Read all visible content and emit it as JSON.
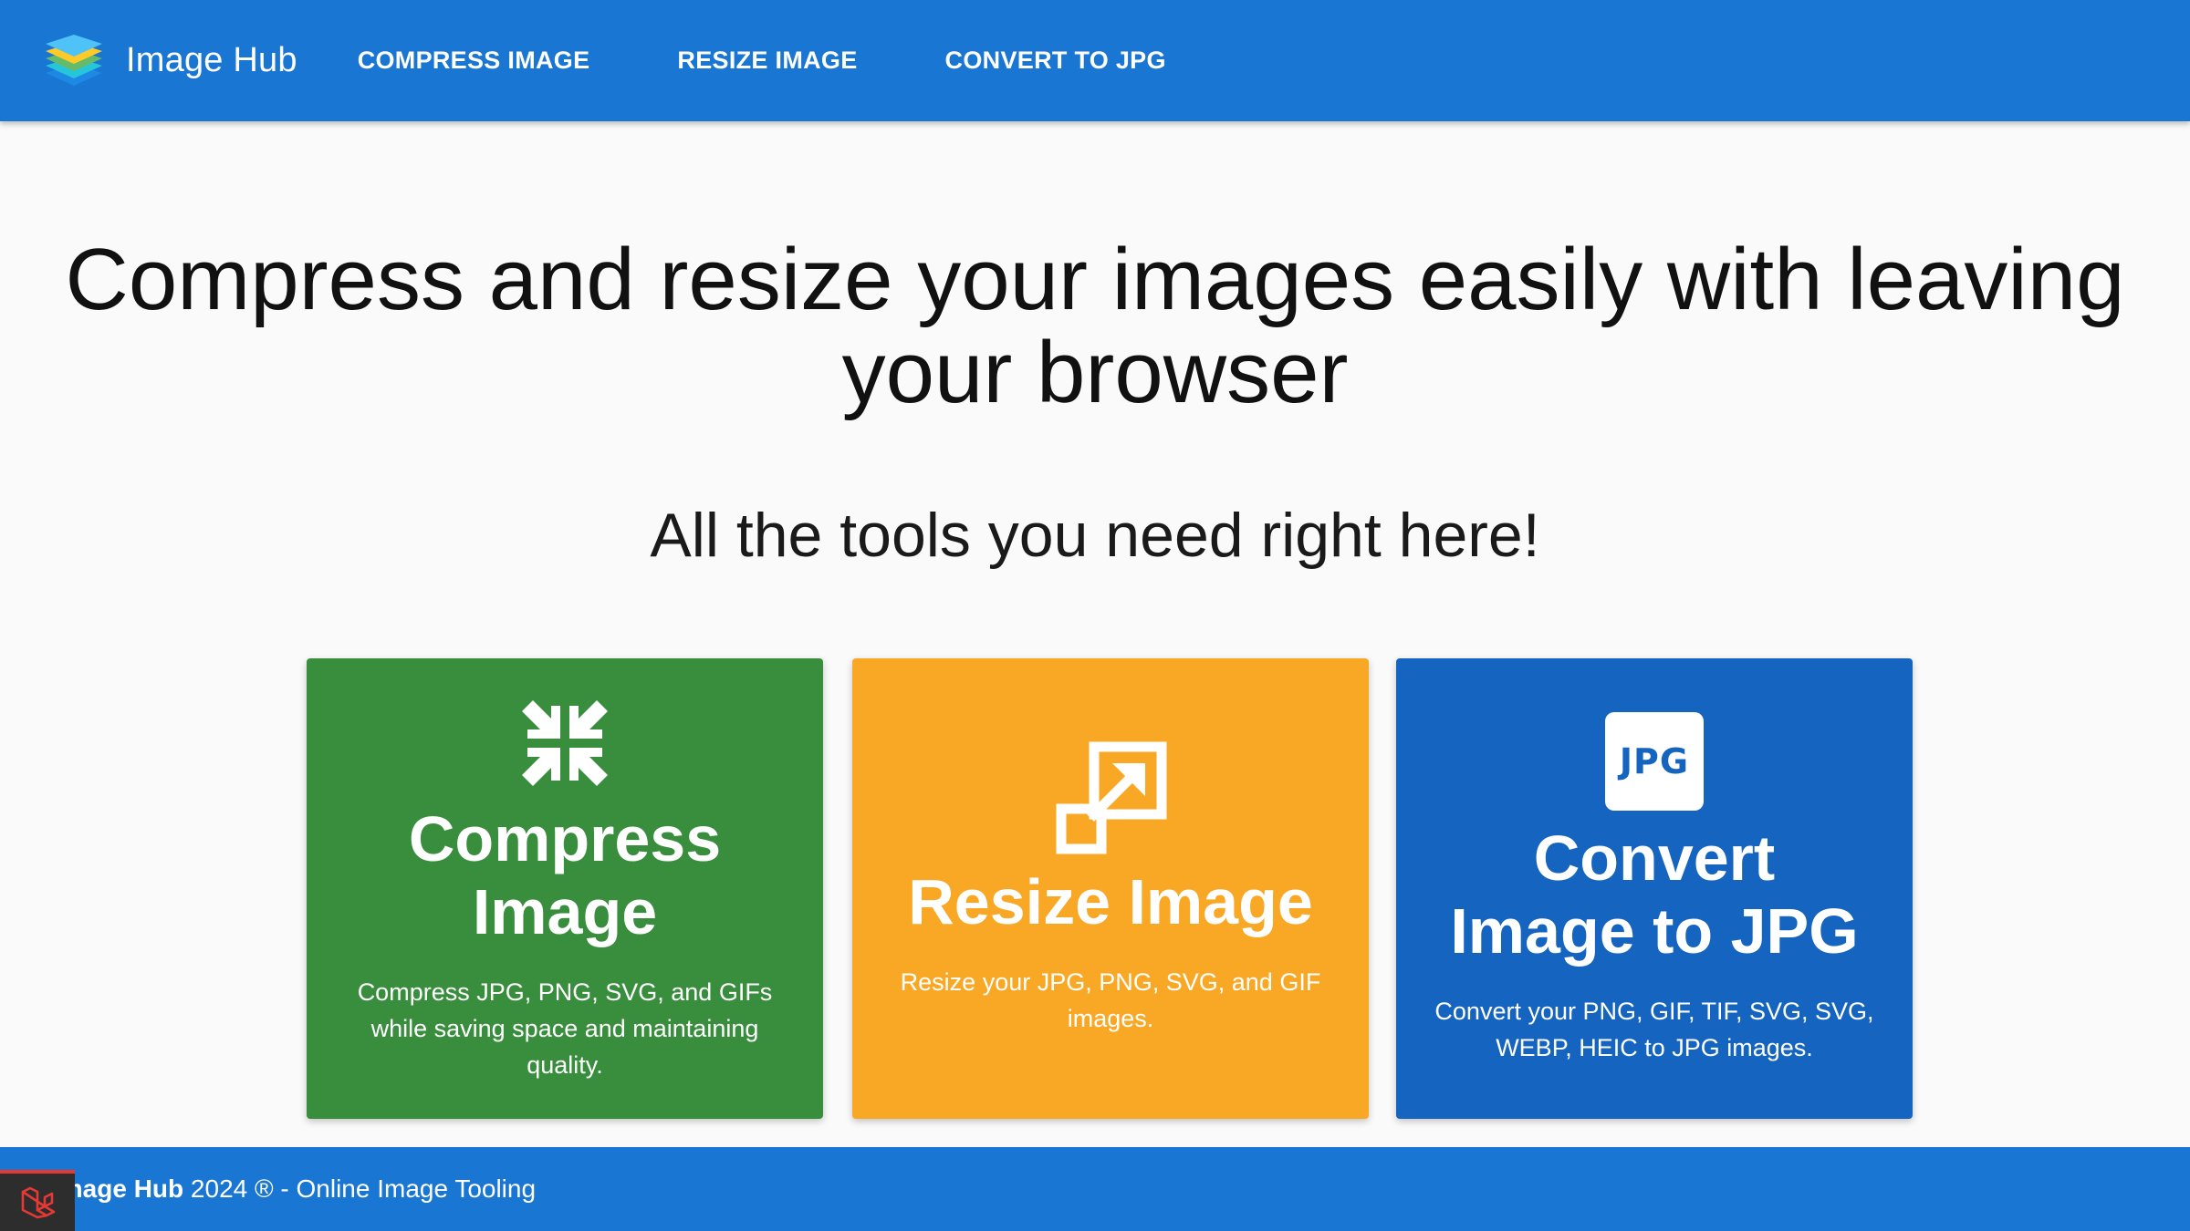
{
  "navbar": {
    "brand": "Image Hub",
    "links": [
      "COMPRESS IMAGE",
      "RESIZE IMAGE",
      "CONVERT TO JPG"
    ],
    "color": "#1976d2"
  },
  "hero": {
    "title": "Compress and resize your images easily with leaving your browser",
    "subtitle": "All the tools you need right here!"
  },
  "cards": [
    {
      "title": "Compress Image",
      "description": "Compress JPG, PNG, SVG, and GIFs while saving space and maintaining quality.",
      "icon": "compress-arrows-icon",
      "color": "#388e3c"
    },
    {
      "title": "Resize Image",
      "description": "Resize your JPG, PNG, SVG, and GIF images.",
      "icon": "resize-icon",
      "color": "#f9a825"
    },
    {
      "title": "Convert Image to JPG",
      "description": "Convert your PNG, GIF, TIF, SVG, SVG, WEBP, HEIC to JPG images.",
      "icon": "jpg-icon",
      "icon_text": "JPG",
      "color": "#1565c0"
    }
  ],
  "footer": {
    "brand": "Image Hub",
    "text": " 2024 ® - Online Image Tooling",
    "color": "#1976d2"
  }
}
